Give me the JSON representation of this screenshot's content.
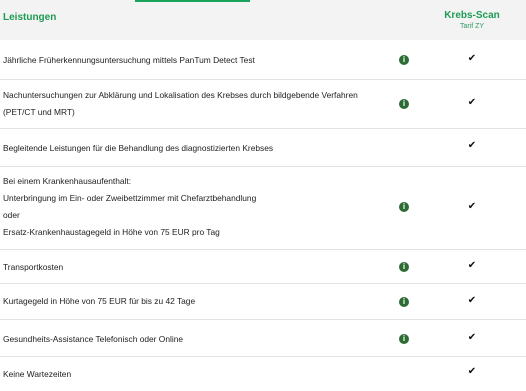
{
  "header": {
    "left_title": "Leistungen",
    "plan_title": "Krebs-Scan",
    "plan_sub": "Tarif ZY"
  },
  "rows": [
    {
      "text": "Jährliche Früherkennungsuntersuchung mittels PanTum Detect Test",
      "info": true,
      "check": true
    },
    {
      "text": "Nachuntersuchungen zur Abklärung und Lokalisation des Krebses durch bildgebende Verfahren (PET/CT und MRT)",
      "info": true,
      "check": true
    },
    {
      "text": "Begleitende Leistungen für die Behandlung des diagnostizierten Krebses",
      "info": false,
      "check": true
    },
    {
      "text": "Bei einem Krankenhausaufenthalt:\nUnterbringung im Ein- oder Zweibettzimmer mit Chefarztbehandlung\noder\nErsatz-Krankenhaustagegeld in Höhe von 75 EUR pro Tag",
      "info": true,
      "check": true
    },
    {
      "text": "Transportkosten",
      "info": true,
      "check": true
    },
    {
      "text": "Kurtagegeld in Höhe von 75 EUR für bis zu 42 Tage",
      "info": true,
      "check": true
    },
    {
      "text": "Gesundheits-Assistance Telefonisch oder Online",
      "info": true,
      "check": true
    },
    {
      "text": "Keine Wartezeiten",
      "info": false,
      "check": true
    }
  ],
  "icons": {
    "info": "info-icon",
    "check": "checkmark-icon",
    "info_glyph": "i",
    "check_glyph": "✔"
  },
  "colors": {
    "accent": "#1f9b55",
    "info_icon": "#2c6b33",
    "header_bg": "#f2f3f2",
    "divider": "#e1e3e1"
  }
}
